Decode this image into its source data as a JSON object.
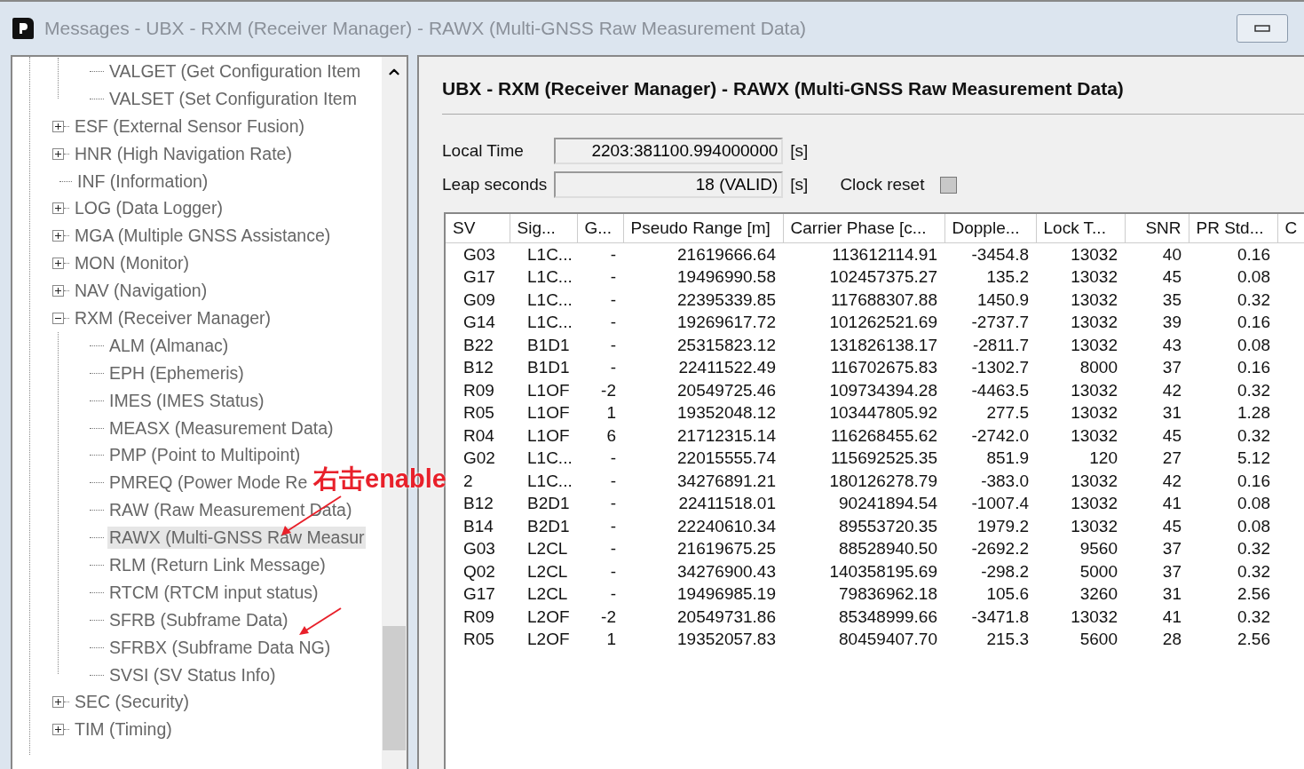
{
  "window": {
    "title": "Messages - UBX - RXM (Receiver Manager) - RAWX (Multi-GNSS Raw Measurement Data)"
  },
  "tree": {
    "items": [
      {
        "kind": "continuation",
        "children": [
          {
            "label": "VALGET (Get Configuration Item",
            "selected": false
          },
          {
            "label": "VALSET (Set Configuration Item",
            "selected": false
          }
        ]
      },
      {
        "label": "ESF (External Sensor Fusion)",
        "selected": false,
        "expanded": false
      },
      {
        "label": "HNR (High Navigation Rate)",
        "selected": false,
        "expanded": false
      },
      {
        "label": "INF (Information)",
        "selected": false
      },
      {
        "label": "LOG (Data Logger)",
        "selected": false,
        "expanded": false
      },
      {
        "label": "MGA (Multiple GNSS Assistance)",
        "selected": false,
        "expanded": false
      },
      {
        "label": "MON (Monitor)",
        "selected": false,
        "expanded": false
      },
      {
        "label": "NAV (Navigation)",
        "selected": false,
        "expanded": false
      },
      {
        "label": "RXM (Receiver Manager)",
        "selected": false,
        "expanded": true,
        "children": [
          {
            "label": "ALM (Almanac)",
            "selected": false
          },
          {
            "label": "EPH (Ephemeris)",
            "selected": false
          },
          {
            "label": "IMES (IMES Status)",
            "selected": false
          },
          {
            "label": "MEASX (Measurement Data)",
            "selected": false
          },
          {
            "label": "PMP (Point to Multipoint)",
            "selected": false
          },
          {
            "label": "PMREQ (Power Mode Re",
            "selected": false
          },
          {
            "label": "RAW (Raw Measurement Data)",
            "selected": false
          },
          {
            "label": "RAWX (Multi-GNSS Raw Measur",
            "selected": true
          },
          {
            "label": "RLM (Return Link Message)",
            "selected": false
          },
          {
            "label": "RTCM (RTCM input status)",
            "selected": false
          },
          {
            "label": "SFRB (Subframe Data)",
            "selected": false
          },
          {
            "label": "SFRBX (Subframe Data NG)",
            "selected": false
          },
          {
            "label": "SVSI (SV Status Info)",
            "selected": false
          }
        ]
      },
      {
        "label": "SEC (Security)",
        "selected": false,
        "expanded": false
      },
      {
        "label": "TIM (Timing)",
        "selected": false,
        "expanded": false
      }
    ]
  },
  "annotation": {
    "text": "右击enable"
  },
  "panel": {
    "heading": "UBX - RXM (Receiver Manager) - RAWX (Multi-GNSS Raw Measurement Data)",
    "fields": [
      {
        "label": "Local Time",
        "value": "2203:381100.994000000",
        "unit": "[s]"
      },
      {
        "label": "Leap seconds",
        "value": "18 (VALID)",
        "unit": "[s]"
      }
    ],
    "clock_reset": {
      "label": "Clock reset",
      "checked": false
    }
  },
  "table": {
    "columns": [
      "SV",
      "Sig...",
      "G...",
      "Pseudo Range [m]",
      "Carrier Phase [c...",
      "Dopple...",
      "Lock T...",
      "SNR",
      "PR Std...",
      "C"
    ],
    "rows": [
      [
        "G03",
        "L1C...",
        "-",
        "21619666.64",
        "113612114.91",
        "-3454.8",
        "13032",
        "40",
        "0.16"
      ],
      [
        "G17",
        "L1C...",
        "-",
        "19496990.58",
        "102457375.27",
        "135.2",
        "13032",
        "45",
        "0.08"
      ],
      [
        "G09",
        "L1C...",
        "-",
        "22395339.85",
        "117688307.88",
        "1450.9",
        "13032",
        "35",
        "0.32"
      ],
      [
        "G14",
        "L1C...",
        "-",
        "19269617.72",
        "101262521.69",
        "-2737.7",
        "13032",
        "39",
        "0.16"
      ],
      [
        "B22",
        "B1D1",
        "-",
        "25315823.12",
        "131826138.17",
        "-2811.7",
        "13032",
        "43",
        "0.08"
      ],
      [
        "B12",
        "B1D1",
        "-",
        "22411522.49",
        "116702675.83",
        "-1302.7",
        "8000",
        "37",
        "0.16"
      ],
      [
        "R09",
        "L1OF",
        "-2",
        "20549725.46",
        "109734394.28",
        "-4463.5",
        "13032",
        "42",
        "0.32"
      ],
      [
        "R05",
        "L1OF",
        "1",
        "19352048.12",
        "103447805.92",
        "277.5",
        "13032",
        "31",
        "1.28"
      ],
      [
        "R04",
        "L1OF",
        "6",
        "21712315.14",
        "116268455.62",
        "-2742.0",
        "13032",
        "45",
        "0.32"
      ],
      [
        "G02",
        "L1C...",
        "-",
        "22015555.74",
        "115692525.35",
        "851.9",
        "120",
        "27",
        "5.12"
      ],
      [
        "2",
        "L1C...",
        "-",
        "34276891.21",
        "180126278.79",
        "-383.0",
        "13032",
        "42",
        "0.16"
      ],
      [
        "B12",
        "B2D1",
        "-",
        "22411518.01",
        "90241894.54",
        "-1007.4",
        "13032",
        "41",
        "0.08"
      ],
      [
        "B14",
        "B2D1",
        "-",
        "22240610.34",
        "89553720.35",
        "1979.2",
        "13032",
        "45",
        "0.08"
      ],
      [
        "G03",
        "L2CL",
        "-",
        "21619675.25",
        "88528940.50",
        "-2692.2",
        "9560",
        "37",
        "0.32"
      ],
      [
        "Q02",
        "L2CL",
        "-",
        "34276900.43",
        "140358195.69",
        "-298.2",
        "5000",
        "37",
        "0.32"
      ],
      [
        "G17",
        "L2CL",
        "-",
        "19496985.19",
        "79836962.18",
        "105.6",
        "3260",
        "31",
        "2.56"
      ],
      [
        "R09",
        "L2OF",
        "-2",
        "20549731.86",
        "85348999.66",
        "-3471.8",
        "13032",
        "41",
        "0.32"
      ],
      [
        "R05",
        "L2OF",
        "1",
        "19352057.83",
        "80459407.70",
        "215.3",
        "5600",
        "28",
        "2.56"
      ]
    ]
  }
}
